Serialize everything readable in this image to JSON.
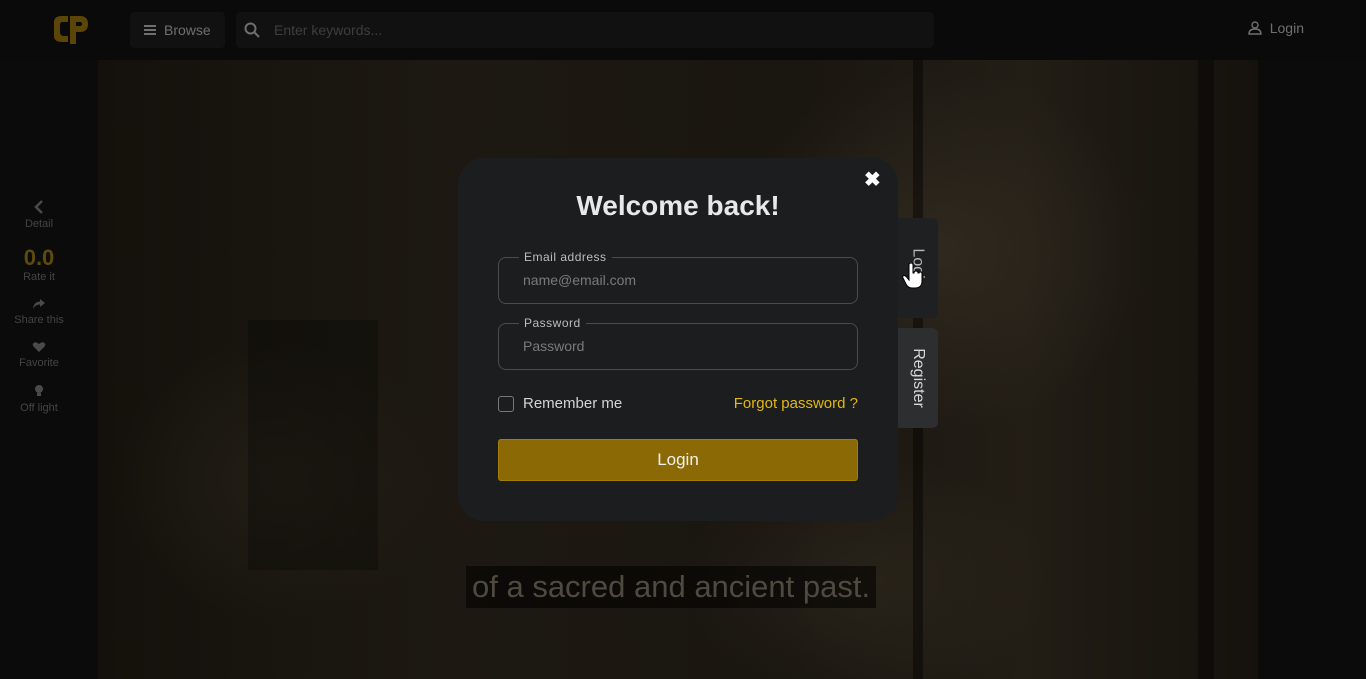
{
  "header": {
    "browse_label": "Browse",
    "search_placeholder": "Enter keywords...",
    "login_label": "Login"
  },
  "rail": {
    "detail_label": "Detail",
    "rating_value": "0.0",
    "rate_label": "Rate it",
    "share_label": "Share this",
    "favorite_label": "Favorite",
    "light_label": "Off light"
  },
  "video": {
    "subtitle": "of a sacred and ancient past."
  },
  "modal": {
    "title": "Welcome back!",
    "email_label": "Email address",
    "email_placeholder": "name@email.com",
    "password_label": "Password",
    "password_placeholder": "Password",
    "remember_label": "Remember me",
    "forgot_label": "Forgot password ?",
    "submit_label": "Login",
    "tabs": {
      "login": "Login",
      "register": "Register"
    }
  },
  "colors": {
    "accent": "#e4b80f",
    "button": "#8b6a05",
    "modal_bg": "#1c1d1f"
  }
}
